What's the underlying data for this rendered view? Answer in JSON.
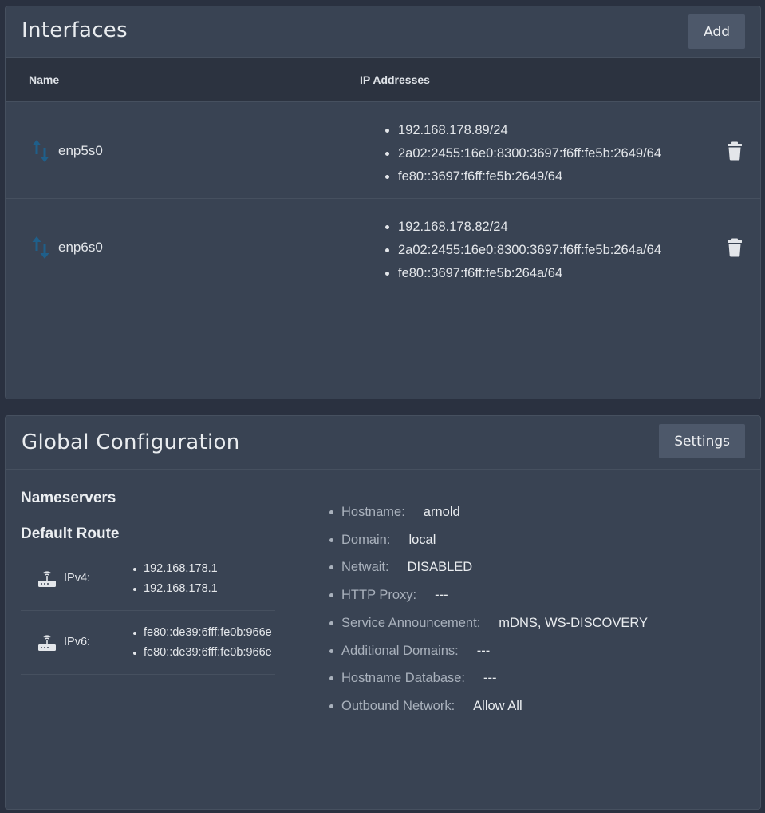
{
  "interfaces": {
    "title": "Interfaces",
    "add_label": "Add",
    "columns": {
      "name": "Name",
      "ip": "IP Addresses"
    },
    "rows": [
      {
        "name": "enp5s0",
        "ips": [
          "192.168.178.89/24",
          "2a02:2455:16e0:8300:3697:f6ff:fe5b:2649/64",
          "fe80::3697:f6ff:fe5b:2649/64"
        ]
      },
      {
        "name": "enp6s0",
        "ips": [
          "192.168.178.82/24",
          "2a02:2455:16e0:8300:3697:f6ff:fe5b:264a/64",
          "fe80::3697:f6ff:fe5b:264a/64"
        ]
      }
    ]
  },
  "global": {
    "title": "Global Configuration",
    "settings_label": "Settings",
    "nameservers_title": "Nameservers",
    "default_route_title": "Default Route",
    "routes": [
      {
        "label": "IPv4:",
        "values": [
          "192.168.178.1",
          "192.168.178.1"
        ]
      },
      {
        "label": "IPv6:",
        "values": [
          "fe80::de39:6fff:fe0b:966e",
          "fe80::de39:6fff:fe0b:966e"
        ]
      }
    ],
    "settings": [
      {
        "key": "Hostname:",
        "value": "arnold"
      },
      {
        "key": "Domain:",
        "value": "local"
      },
      {
        "key": "Netwait:",
        "value": "DISABLED"
      },
      {
        "key": "HTTP Proxy:",
        "value": "---"
      },
      {
        "key": "Service Announcement:",
        "value": "mDNS, WS-DISCOVERY"
      },
      {
        "key": "Additional Domains:",
        "value": "---"
      },
      {
        "key": "Hostname Database:",
        "value": "---"
      },
      {
        "key": "Outbound Network:",
        "value": "Allow All"
      }
    ]
  },
  "icons": {
    "interface": "swap-vertical-icon",
    "delete": "trash-icon",
    "router": "router-wireless-icon"
  },
  "colors": {
    "background": "#2a3140",
    "card": "#394353",
    "table_header": "#2c3340",
    "button": "#4d586a",
    "interface_icon": "#1f5f8a",
    "muted_text": "#a9b1bc"
  }
}
